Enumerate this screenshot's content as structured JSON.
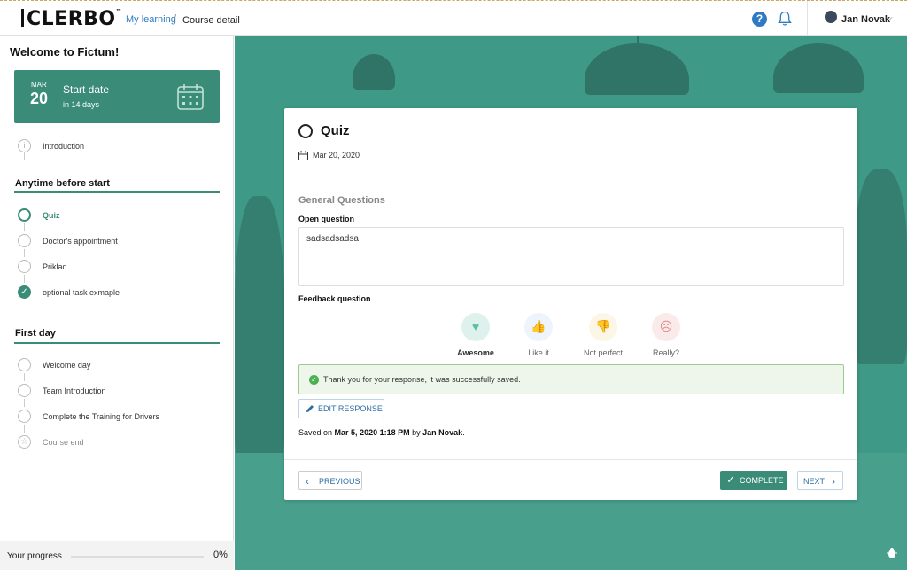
{
  "header": {
    "logo": "CLERBO",
    "breadcrumb_link": "My learning",
    "breadcrumb_sep": "/",
    "breadcrumb_current": "Course detail",
    "help_glyph": "?",
    "user_name": "Jan Novak",
    "user_chevron": "⌵"
  },
  "sidebar": {
    "welcome": "Welcome to Fictum!",
    "start_card": {
      "month": "MAR",
      "day": "20",
      "label": "Start date",
      "sub": "in 14 days"
    },
    "intro": {
      "label": "Introduction",
      "icon": "info-icon"
    },
    "sections": [
      {
        "title": "Anytime before start",
        "items": [
          {
            "label": "Quiz",
            "state": "active"
          },
          {
            "label": "Doctor's appointment",
            "state": "open"
          },
          {
            "label": "Priklad",
            "state": "open"
          },
          {
            "label": "optional task exmaple",
            "state": "done"
          }
        ]
      },
      {
        "title": "First day",
        "items": [
          {
            "label": "Welcome day",
            "state": "open"
          },
          {
            "label": "Team Introduction",
            "state": "open"
          },
          {
            "label": "Complete the Training for Drivers",
            "state": "open"
          },
          {
            "label": "Course end",
            "state": "end"
          }
        ]
      }
    ],
    "progress": {
      "label": "Your progress",
      "value": 0,
      "text": "0%"
    }
  },
  "card": {
    "title": "Quiz",
    "date": "Mar 20, 2020",
    "section_title": "General Questions",
    "open_question_label": "Open question",
    "open_answer": "sadsadsadsa",
    "feedback_label": "Feedback question",
    "feedback_options": [
      {
        "label": "Awesome",
        "glyph": "♥",
        "selected": true,
        "color": "#5cc0a0",
        "bg": "#dff1ec"
      },
      {
        "label": "Like it",
        "glyph": "👍",
        "selected": false,
        "color": "#8ab6e0",
        "bg": "#eef4fb"
      },
      {
        "label": "Not perfect",
        "glyph": "👎",
        "selected": false,
        "color": "#ecd58a",
        "bg": "#fcf6e6"
      },
      {
        "label": "Really?",
        "glyph": "☹",
        "selected": false,
        "color": "#e08a8a",
        "bg": "#fbeaea"
      }
    ],
    "success_message": "Thank you for your response, it was successfully saved.",
    "edit_label": "EDIT RESPONSE",
    "saved": {
      "prefix": "Saved on",
      "when": "Mar 5, 2020 1:18 PM",
      "by": "by",
      "who": "Jan Novak",
      "suffix": "."
    },
    "prev_label": "PREVIOUS",
    "complete_label": "COMPLETE",
    "next_label": "NEXT"
  },
  "colors": {
    "accent": "#3a8b78",
    "link": "#2e7bc4"
  }
}
